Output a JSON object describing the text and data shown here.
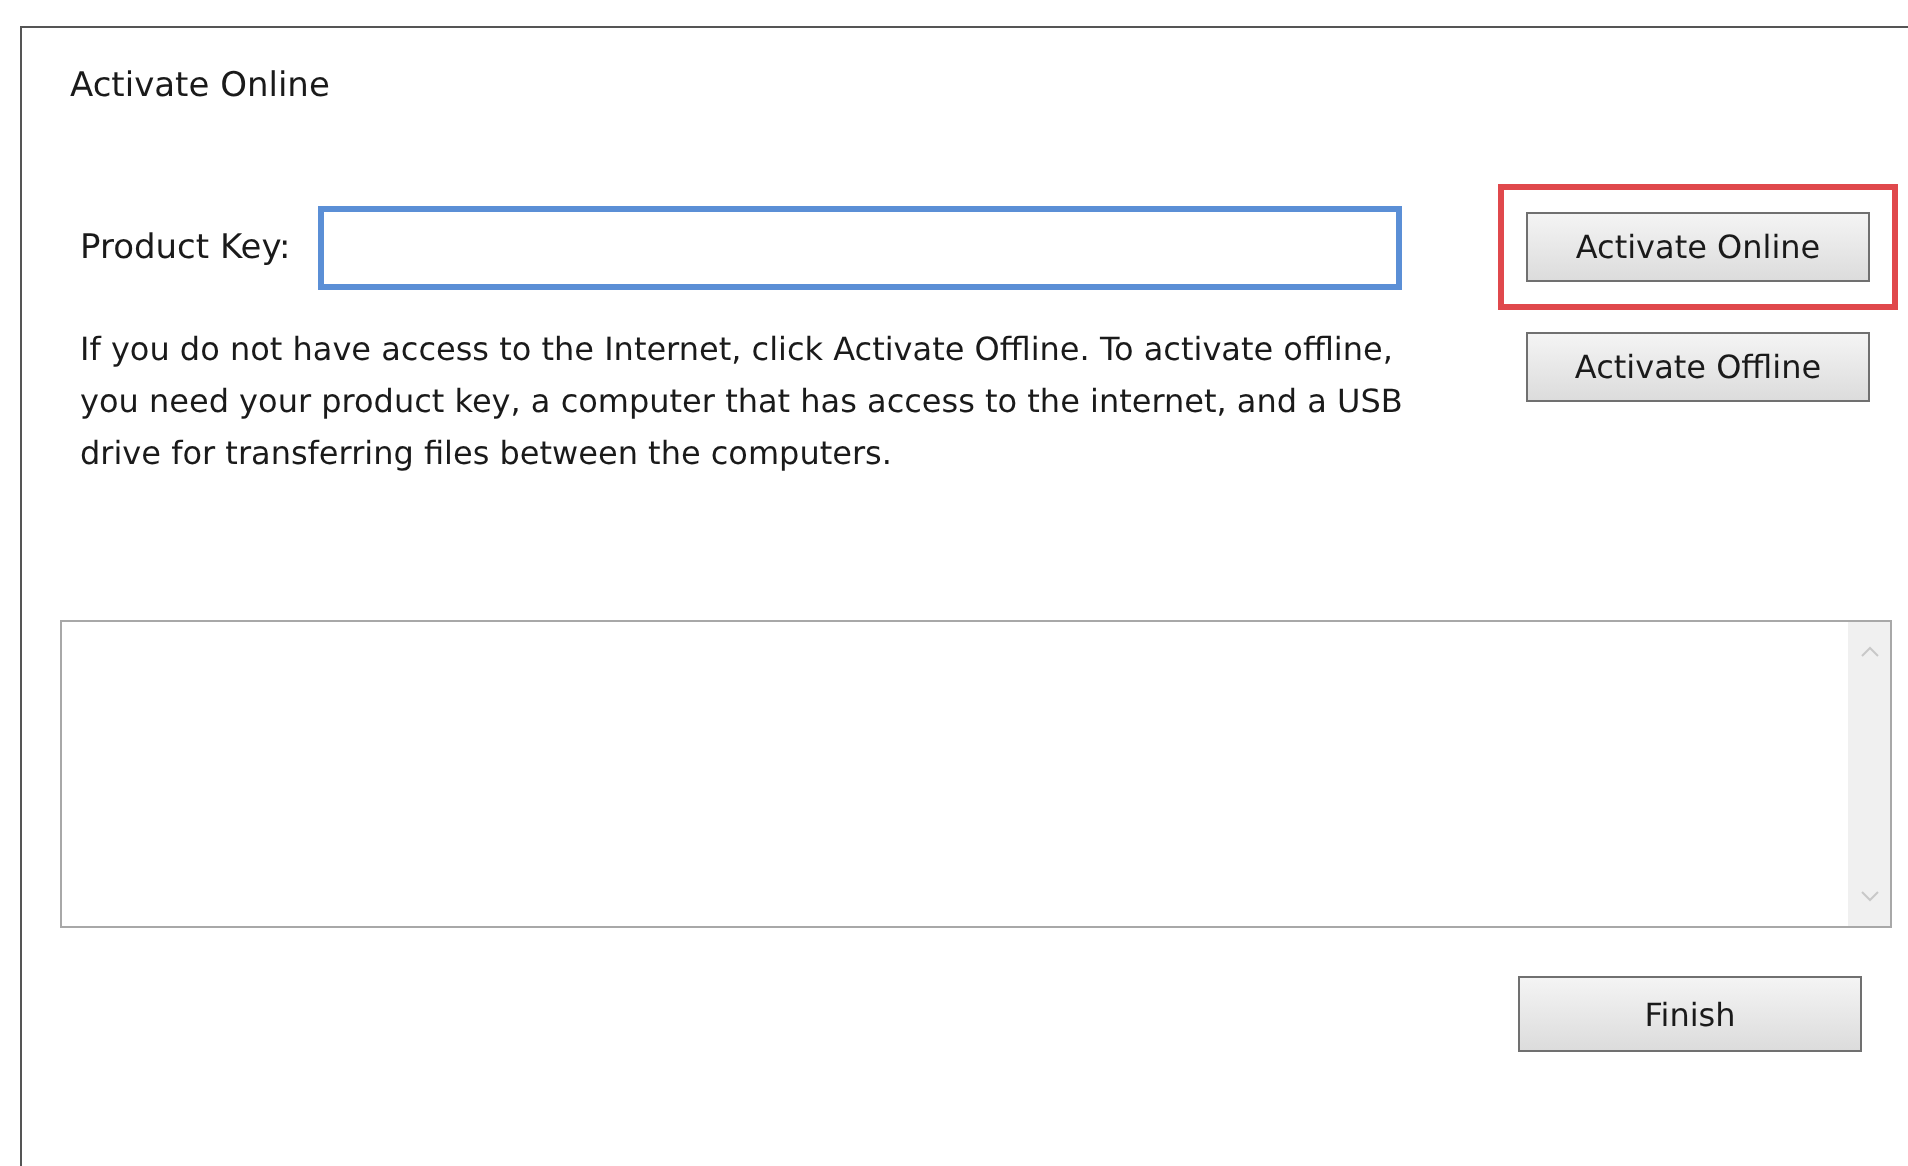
{
  "dialog": {
    "title": "Activate Online"
  },
  "product_key": {
    "label": "Product Key:",
    "focused": true
  },
  "buttons": [
    {
      "label": "Activate Online",
      "highlighted": true
    },
    {
      "label": "Activate Offline",
      "highlighted": false
    }
  ],
  "instructions": "If you do not have access to the Internet, click Activate Offline. To activate offline, you need your product key, a computer that has access to the internet, and a USB drive for transferring files between the computers.",
  "finish_button": {
    "label": "Finish"
  }
}
